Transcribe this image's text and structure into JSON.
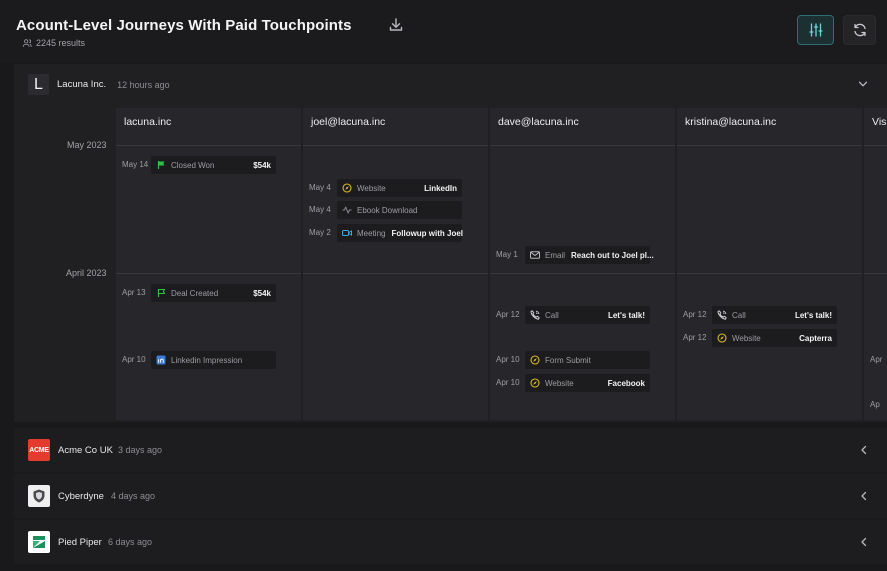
{
  "header": {
    "title": "Acount-Level Journeys With Paid Touchpoints",
    "results": "2245 results"
  },
  "expanded_account": {
    "name": "Lacuna Inc.",
    "time": "12 hours ago",
    "logo_letter": "L"
  },
  "months": [
    "May 2023",
    "April 2023"
  ],
  "columns": [
    {
      "title": "lacuna.inc",
      "events": [
        {
          "date": "May 14",
          "type": "Closed Won",
          "value": "$54k",
          "icon": "flag-icon",
          "color": "#2fbf4a"
        },
        {
          "date": "Apr 13",
          "type": "Deal Created",
          "value": "$54k",
          "icon": "flag-outline-icon",
          "color": "#2fbf4a"
        },
        {
          "date": "Apr 10",
          "type": "Linkedin Impression",
          "value": "",
          "icon": "linkedin-icon",
          "color": "#3a7bd5"
        }
      ]
    },
    {
      "title": "joel@lacuna.inc",
      "events": [
        {
          "date": "May 4",
          "type": "Website",
          "value": "LinkedIn",
          "icon": "compass-icon",
          "color": "#d9b825"
        },
        {
          "date": "May 4",
          "type": "Ebook Download",
          "value": "",
          "icon": "activity-icon",
          "color": "#8a8a90"
        },
        {
          "date": "May 2",
          "type": "Meeting",
          "value": "Followup with Joel",
          "icon": "video-icon",
          "color": "#3aa6d9"
        }
      ]
    },
    {
      "title": "dave@lacuna.inc",
      "events": [
        {
          "date": "May 1",
          "type": "Email",
          "value": "Reach out to Joel pl...",
          "icon": "mail-icon",
          "color": "#b6b6bc"
        },
        {
          "date": "Apr 12",
          "type": "Call",
          "value": "Let's talk!",
          "icon": "phone-icon",
          "color": "#d0d0d6"
        },
        {
          "date": "Apr 10",
          "type": "Form Submit",
          "value": "",
          "icon": "compass-icon",
          "color": "#d9b825"
        },
        {
          "date": "Apr 10",
          "type": "Website",
          "value": "Facebook",
          "icon": "compass-icon",
          "color": "#d9b825"
        }
      ]
    },
    {
      "title": "kristina@lacuna.inc",
      "events": [
        {
          "date": "Apr 12",
          "type": "Call",
          "value": "Let's talk!",
          "icon": "phone-icon",
          "color": "#d0d0d6"
        },
        {
          "date": "Apr 12",
          "type": "Website",
          "value": "Capterra",
          "icon": "compass-icon",
          "color": "#d9b825"
        }
      ]
    },
    {
      "title": "Vis",
      "events": [
        {
          "date": "Apr",
          "type": "",
          "value": "",
          "icon": "",
          "color": ""
        },
        {
          "date": "Ap",
          "type": "",
          "value": "",
          "icon": "",
          "color": ""
        }
      ]
    }
  ],
  "accounts": [
    {
      "name": "Acme Co UK",
      "time": "3 days ago",
      "logo_text": "ACME",
      "logo_color": "#e33b2e"
    },
    {
      "name": "Cyberdyne",
      "time": "4 days ago",
      "logo_color": "#f0f0f0"
    },
    {
      "name": "Pied Piper",
      "time": "6 days ago",
      "logo_color": "#ffffff"
    }
  ]
}
